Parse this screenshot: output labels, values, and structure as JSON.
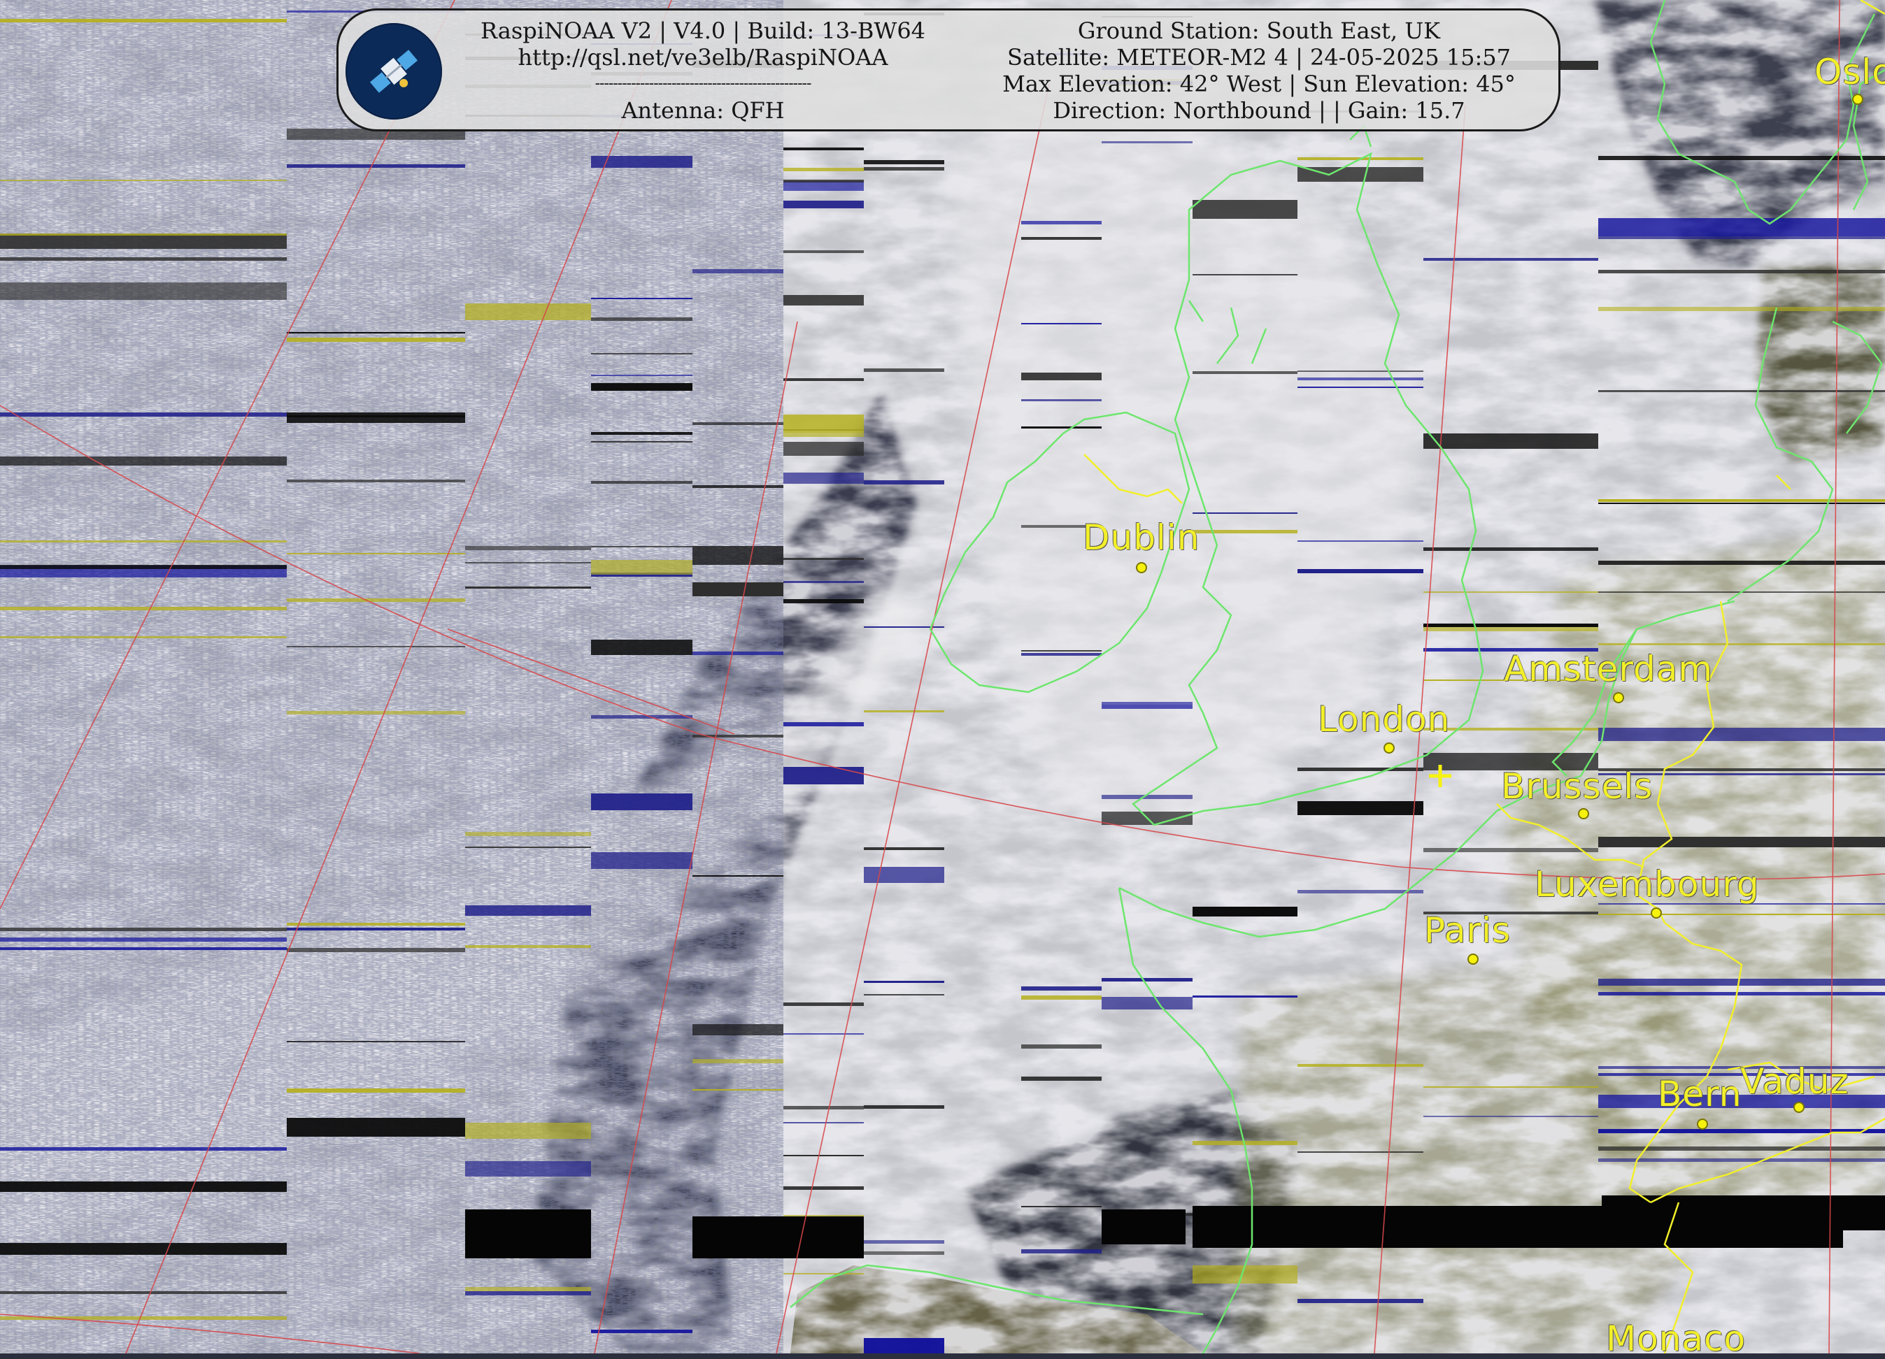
{
  "header": {
    "line_1_left": "RaspiNOAA V2 | V4.0 | Build: 13-BW64",
    "line_2_left": "http://qsl.net/ve3elb/RaspiNOAA",
    "line_3_left": "------------------------------------------------",
    "line_4_left": "Antenna: QFH",
    "line_1_right": "Ground Station: South East, UK",
    "line_2_right": "Satellite: METEOR-M2 4 | 24-05-2025 15:57",
    "line_3_right": "Max Elevation: 42° West | Sun Elevation: 45°",
    "line_4_right": "Direction: Northbound | | Gain: 15.7"
  },
  "logo_icon": "satellite-icon",
  "ground_station_marker": "+",
  "cities": {
    "oslo": "Oslo",
    "dublin": "Dublin",
    "amsterdam": "Amsterdam",
    "london": "London",
    "brussels": "Brussels",
    "luxembourg": "Luxembourg",
    "paris": "Paris",
    "bern": "Bern",
    "vaduz": "Vaduz",
    "monaco": "Monaco"
  },
  "colors": {
    "coastline": "#6de66d",
    "border": "#f2ef2a",
    "graticule": "#d8474a",
    "city_label": "#f2ef2a",
    "noise_blue": "#12129c",
    "noise_yellow": "#b5b01e"
  }
}
